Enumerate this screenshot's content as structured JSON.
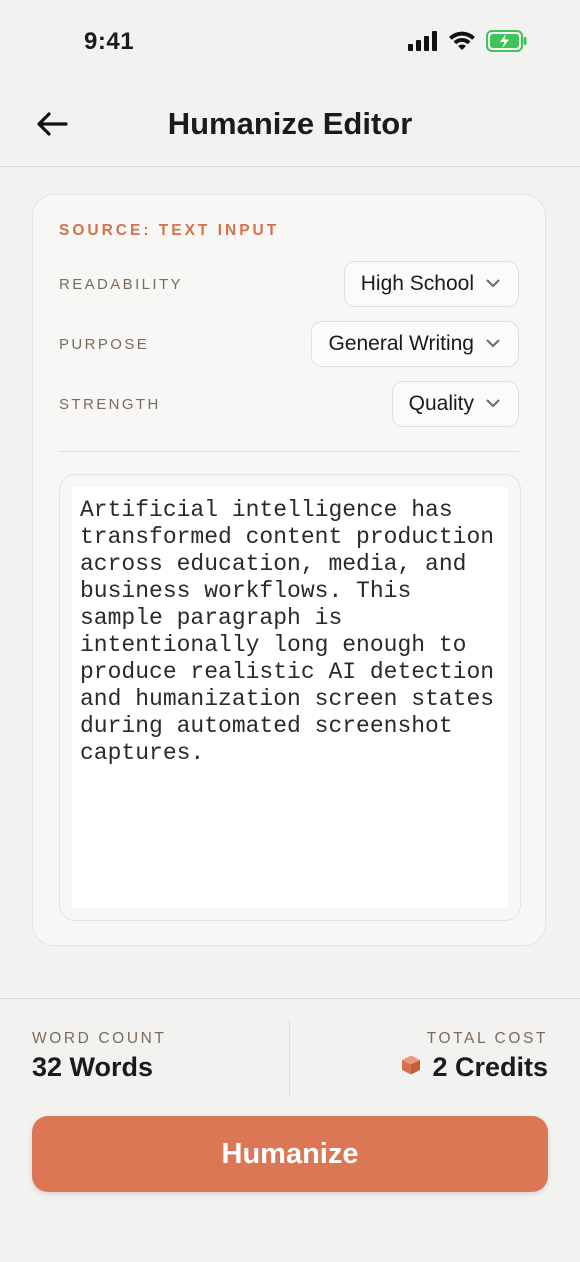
{
  "status_bar": {
    "time": "9:41"
  },
  "header": {
    "title": "Humanize Editor"
  },
  "card": {
    "source_label": "SOURCE: TEXT INPUT",
    "settings": [
      {
        "label": "READABILITY",
        "value": "High School"
      },
      {
        "label": "PURPOSE",
        "value": "General Writing"
      },
      {
        "label": "STRENGTH",
        "value": "Quality"
      }
    ],
    "editor_text": "Artificial intelligence has transformed content production across education, media, and business workflows. This sample paragraph is intentionally long enough to produce realistic AI detection and humanization screen states during automated screenshot captures."
  },
  "footer": {
    "word_count_label": "WORD COUNT",
    "word_count_value": "32 Words",
    "total_cost_label": "TOTAL COST",
    "total_cost_value": "2 Credits"
  },
  "action": {
    "label": "Humanize"
  },
  "colors": {
    "accent": "#dc7755",
    "label_brown": "#7d6b5a",
    "battery_green": "#3fc35a"
  },
  "icons": [
    "back-arrow-icon",
    "cellular-signal-icon",
    "wifi-icon",
    "battery-charging-icon",
    "chevron-down-icon",
    "credits-box-icon"
  ]
}
